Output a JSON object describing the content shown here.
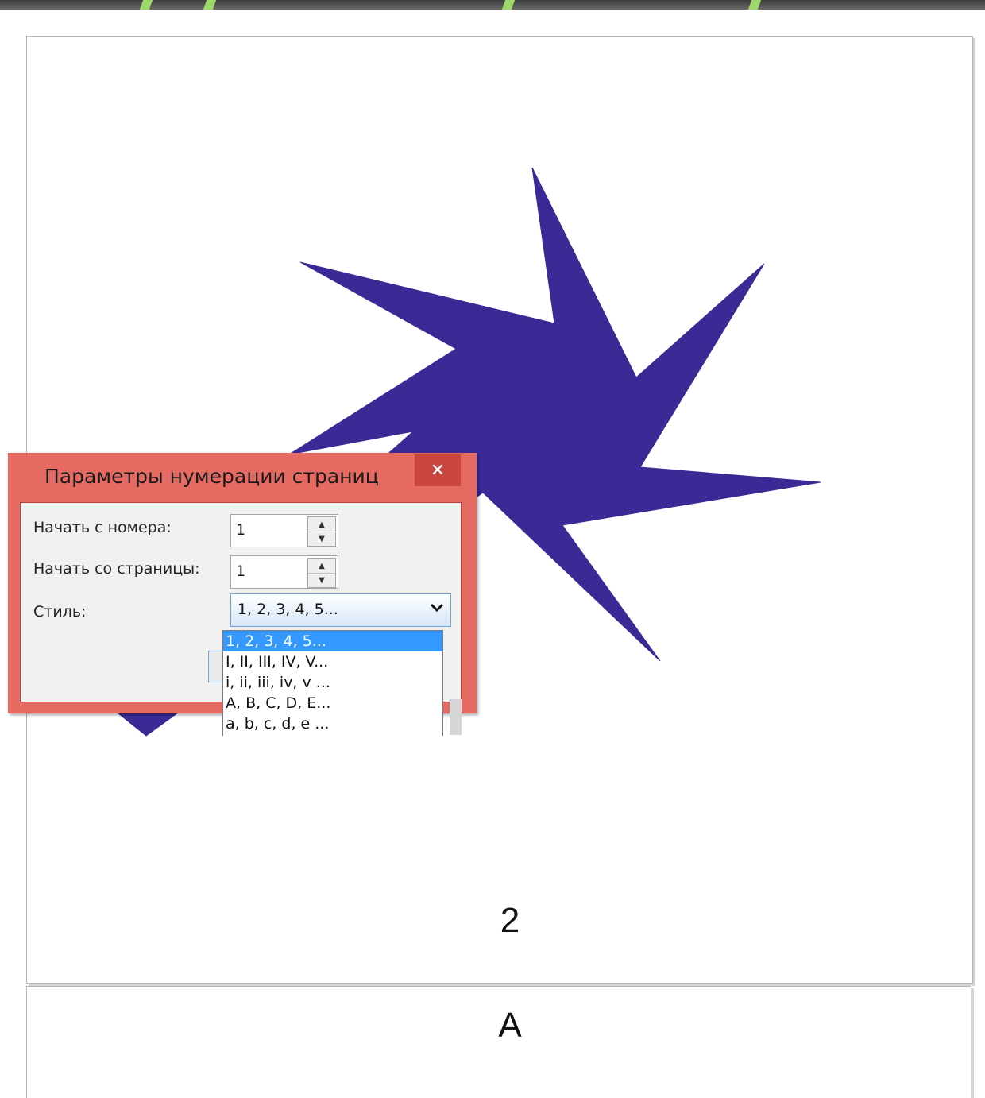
{
  "colors": {
    "star_fill": "#3a2a96",
    "dialog_frame": "#e46a62",
    "close_button": "#c9453d",
    "selected_option": "#3399ff"
  },
  "pages": [
    {
      "number": "2"
    },
    {
      "number": "A"
    }
  ],
  "dialog": {
    "title": "Параметры нумерации страниц",
    "close_label": "✕",
    "fields": {
      "start_number": {
        "label": "Начать с номера:",
        "value": "1"
      },
      "start_page": {
        "label": "Начать со страницы:",
        "value": "1"
      },
      "style": {
        "label": "Стиль:",
        "value": "1, 2, 3, 4, 5..."
      }
    },
    "style_options": [
      "1, 2, 3, 4, 5...",
      "I, II, III, IV, V...",
      "i, ii, iii, iv, v ...",
      "A, B, C, D, E...",
      "a, b, c, d, e ..."
    ],
    "selected_option_index": 0
  }
}
